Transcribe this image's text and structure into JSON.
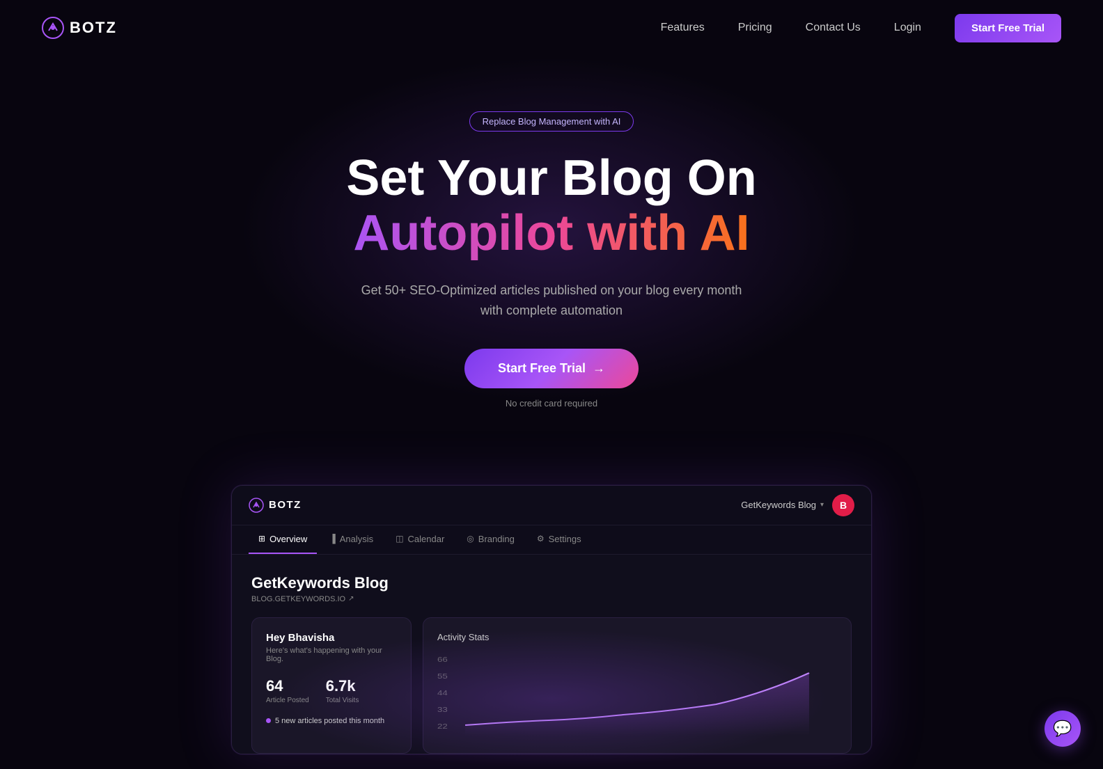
{
  "brand": {
    "name": "BOTZ",
    "logo_alt": "Botz logo"
  },
  "navbar": {
    "links": [
      {
        "label": "Features",
        "id": "features"
      },
      {
        "label": "Pricing",
        "id": "pricing"
      },
      {
        "label": "Contact Us",
        "id": "contact"
      },
      {
        "label": "Login",
        "id": "login"
      }
    ],
    "cta": "Start Free Trial"
  },
  "hero": {
    "badge": "Replace Blog Management with AI",
    "title_line1": "Set Your Blog On",
    "title_line2": "Autopilot with AI",
    "subtitle_line1": "Get 50+ SEO-Optimized articles published on your blog every month",
    "subtitle_line2": "with complete automation",
    "cta_button": "Start Free Trial",
    "cta_arrow": "→",
    "no_cc": "No credit card required"
  },
  "app_preview": {
    "logo": "BOTZ",
    "blog_selector": "GetKeywords Blog",
    "avatar_letter": "B",
    "tabs": [
      {
        "label": "Overview",
        "icon": "⊞",
        "active": true
      },
      {
        "label": "Analysis",
        "icon": "▐",
        "active": false
      },
      {
        "label": "Calendar",
        "icon": "◫",
        "active": false
      },
      {
        "label": "Branding",
        "icon": "◎",
        "active": false
      },
      {
        "label": "Settings",
        "icon": "⚙",
        "active": false
      }
    ],
    "blog_title": "GetKeywords Blog",
    "blog_url": "BLOG.GETKEYWORDS.IO",
    "card_left": {
      "greeting": "Hey Bhavisha",
      "subtitle": "Here's what's happening with your Blog.",
      "stats": [
        {
          "value": "64",
          "label": "Article Posted"
        },
        {
          "value": "6.7k",
          "label": "Total Visits"
        }
      ],
      "highlight": "5 new articles posted this month"
    },
    "card_right": {
      "title": "Activity Stats",
      "y_labels": [
        "66",
        "55",
        "44",
        "33",
        "22"
      ]
    }
  },
  "chat_button": {
    "icon": "💬"
  }
}
